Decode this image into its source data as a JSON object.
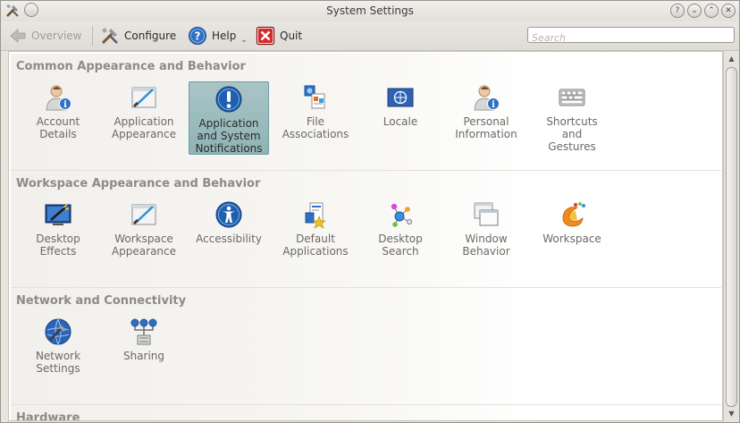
{
  "window": {
    "title": "System Settings"
  },
  "toolbar": {
    "overview": "Overview",
    "configure": "Configure",
    "help": "Help",
    "quit": "Quit",
    "search_placeholder": "Search"
  },
  "sections": [
    {
      "title": "Common Appearance and Behavior",
      "items": [
        {
          "label": "Account\nDetails",
          "icon": "account-details-icon"
        },
        {
          "label": "Application\nAppearance",
          "icon": "application-appearance-icon"
        },
        {
          "label": "Application\nand System\nNotifications",
          "icon": "notifications-icon",
          "selected": true
        },
        {
          "label": "File\nAssociations",
          "icon": "file-associations-icon"
        },
        {
          "label": "Locale",
          "icon": "locale-icon"
        },
        {
          "label": "Personal\nInformation",
          "icon": "personal-information-icon"
        },
        {
          "label": "Shortcuts\nand\nGestures",
          "icon": "shortcuts-icon"
        }
      ]
    },
    {
      "title": "Workspace Appearance and Behavior",
      "items": [
        {
          "label": "Desktop\nEffects",
          "icon": "desktop-effects-icon"
        },
        {
          "label": "Workspace\nAppearance",
          "icon": "workspace-appearance-icon"
        },
        {
          "label": "Accessibility",
          "icon": "accessibility-icon"
        },
        {
          "label": "Default\nApplications",
          "icon": "default-applications-icon"
        },
        {
          "label": "Desktop\nSearch",
          "icon": "desktop-search-icon"
        },
        {
          "label": "Window\nBehavior",
          "icon": "window-behavior-icon"
        },
        {
          "label": "Workspace",
          "icon": "workspace-icon"
        }
      ]
    },
    {
      "title": "Network and Connectivity",
      "items": [
        {
          "label": "Network\nSettings",
          "icon": "network-settings-icon"
        },
        {
          "label": "Sharing",
          "icon": "sharing-icon"
        }
      ]
    },
    {
      "title": "Hardware",
      "items": []
    }
  ]
}
